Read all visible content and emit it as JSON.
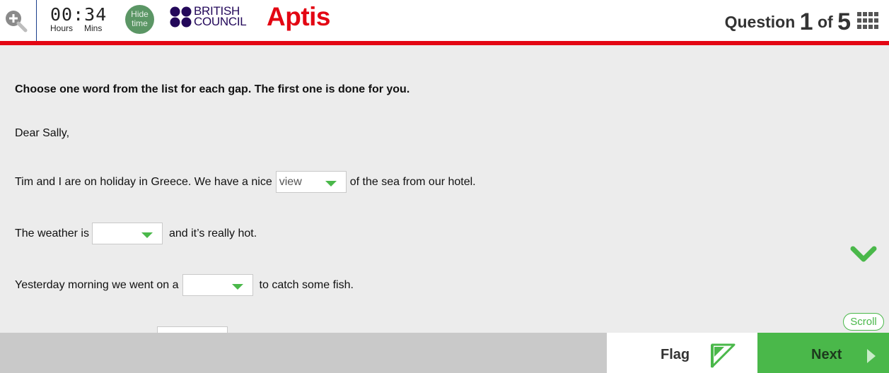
{
  "header": {
    "zoom_icon": "zoom-in-icon",
    "timer": {
      "value": "00:34",
      "hours_label": "Hours",
      "mins_label": "Mins"
    },
    "hide_time": {
      "line1": "Hide",
      "line2": "time"
    },
    "logo": {
      "line1": "BRITISH",
      "line2": "COUNCIL"
    },
    "product": "Aptis",
    "question": {
      "prefix": "Question",
      "current": "1",
      "of": "of",
      "total": "5"
    },
    "grid_icon": "question-grid-icon"
  },
  "colors": {
    "accent_red": "#e30613",
    "accent_green": "#4ab84a",
    "hide_time_green": "#5b9665",
    "logo_blue": "#23085a"
  },
  "main": {
    "instruction": "Choose one word from the list for each gap. The first one is done for you.",
    "greeting": "Dear Sally,",
    "lines": [
      {
        "before": "Tim and I are on holiday in Greece. We have a nice",
        "selected": "view",
        "after": "of the sea from our hotel."
      },
      {
        "before": "The weather is",
        "selected": "",
        "after": "and it’s really hot."
      },
      {
        "before": "Yesterday morning we went on a",
        "selected": "",
        "after": "to catch some fish."
      }
    ],
    "scroll_label": "Scroll"
  },
  "footer": {
    "flag_label": "Flag",
    "next_label": "Next"
  }
}
